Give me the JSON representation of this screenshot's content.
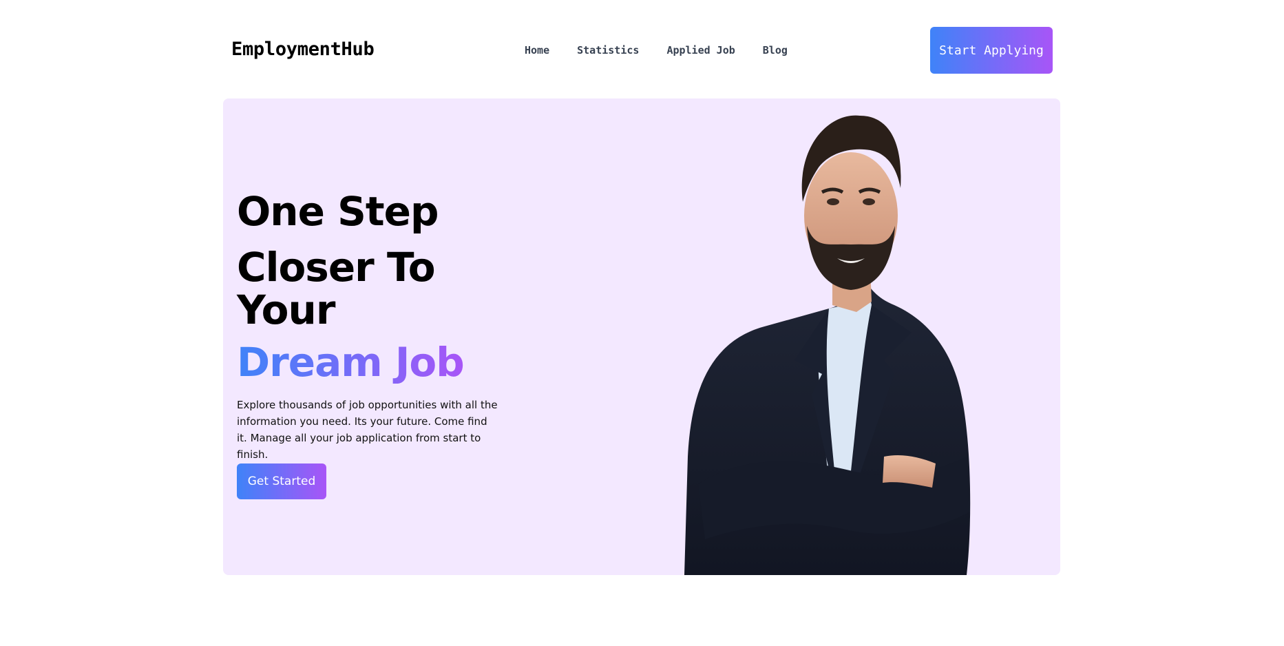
{
  "header": {
    "logo": "EmploymentHub",
    "nav": [
      {
        "label": "Home"
      },
      {
        "label": "Statistics"
      },
      {
        "label": "Applied Job"
      },
      {
        "label": "Blog"
      }
    ],
    "cta_label": "Start Applying"
  },
  "hero": {
    "headline_line1": "One Step",
    "headline_line2": "Closer To Your",
    "headline_highlight": "Dream Job",
    "description": "Explore thousands of job opportunities with all the information you need. Its your future. Come find it. Manage all your job application from start to finish.",
    "button_label": "Get Started",
    "image_subject": "man-in-suit-photo"
  },
  "colors": {
    "gradient_start": "#3f83f8",
    "gradient_end": "#a855f7",
    "hero_background": "#f3e8ff",
    "nav_text": "#374151"
  }
}
